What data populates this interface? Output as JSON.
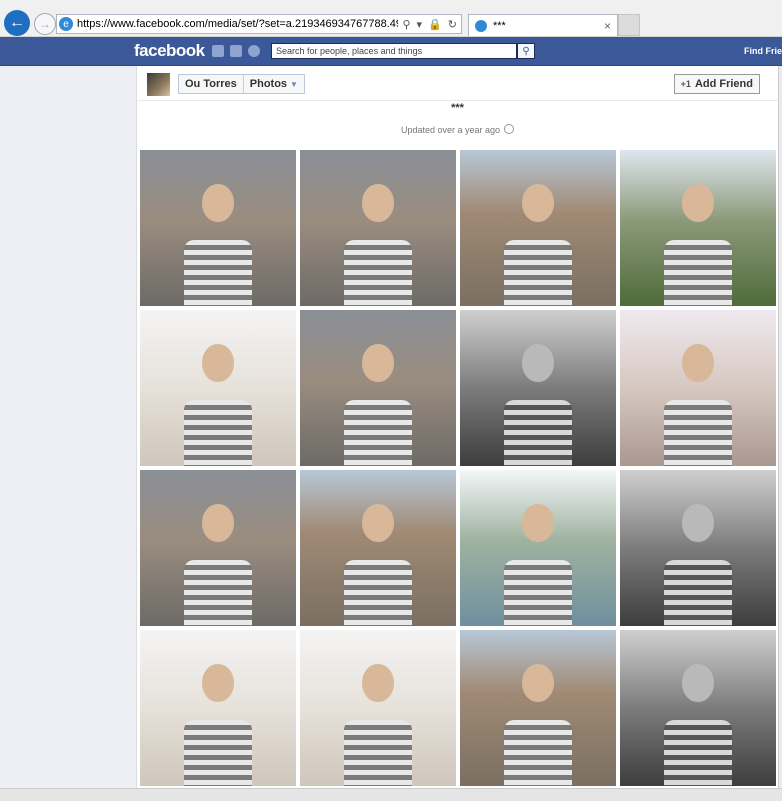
{
  "browser": {
    "url": "https://www.facebook.com/media/set/?set=a.219346934767788.49268.100000774500",
    "tab_title": "***",
    "tab_close": "×"
  },
  "header": {
    "logo": "facebook",
    "search_placeholder": "Search for people, places and things",
    "find_friends": "Find Frie"
  },
  "profile": {
    "name": "Ou Torres",
    "section": "Photos",
    "add_friend_label": "Add Friend"
  },
  "album": {
    "title": "***",
    "updated": "Updated over a year ago"
  },
  "photos": [
    {
      "tone": "street"
    },
    {
      "tone": "street"
    },
    {
      "tone": "city"
    },
    {
      "tone": "park"
    },
    {
      "tone": "bright"
    },
    {
      "tone": "street"
    },
    {
      "tone": "bw"
    },
    {
      "tone": "indoor"
    },
    {
      "tone": "street"
    },
    {
      "tone": "city"
    },
    {
      "tone": "river"
    },
    {
      "tone": "bw"
    },
    {
      "tone": "bright"
    },
    {
      "tone": "bright"
    },
    {
      "tone": "city"
    },
    {
      "tone": "bw"
    }
  ],
  "colors": {
    "facebook_blue": "#3b5998",
    "browser_back": "#1e6fc1"
  }
}
